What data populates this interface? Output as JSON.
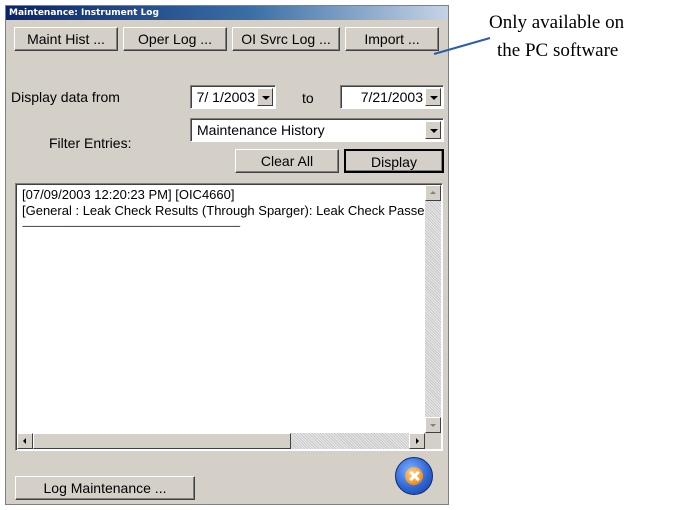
{
  "window": {
    "title": "Maintenance: Instrument Log"
  },
  "toolbar": {
    "maint_hist": "Maint Hist ...",
    "oper_log": "Oper Log ...",
    "oi_svrc_log": "OI Svrc Log ...",
    "import": "Import ..."
  },
  "date_range": {
    "label": "Display data from",
    "from": "7/ 1/2003",
    "to_label": "to",
    "to": "7/21/2003"
  },
  "filter": {
    "label": "Filter Entries:",
    "selected": "Maintenance History"
  },
  "actions": {
    "clear_all": "Clear All",
    "display": "Display"
  },
  "log": {
    "lines": [
      "[07/09/2003 12:20:23 PM] [OIC4660]",
      "[General : Leak Check Results (Through Sparger): Leak Check Passed]",
      "-------------------------------------------------------------------------------------------------------------"
    ]
  },
  "footer": {
    "log_maintenance": "Log Maintenance ..."
  },
  "annotation": {
    "line1": "Only available on",
    "line2": "the PC software"
  },
  "colors": {
    "titlebar": "#0a246a",
    "dialog": "#d4d0c8",
    "close_button": "#2f66d6"
  },
  "icons": {
    "close": "close-x-icon"
  }
}
